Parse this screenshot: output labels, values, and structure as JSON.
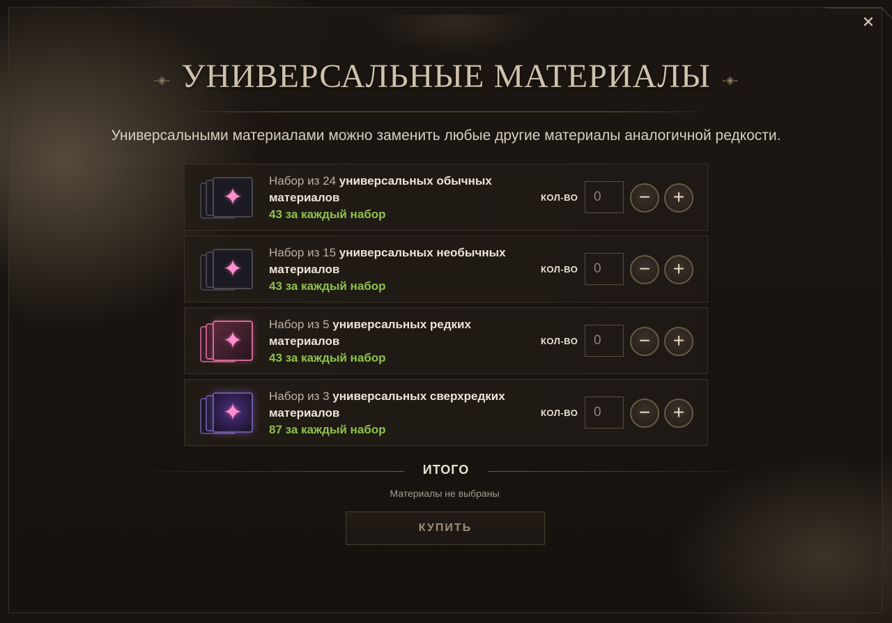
{
  "dialog": {
    "title": "УНИВЕРСАЛЬНЫЕ МАТЕРИАЛЫ",
    "close_glyph": "✕",
    "description": "Универсальными материалами можно заменить любые другие материалы аналогичной редкости."
  },
  "items": [
    {
      "prefix": "Набор из 24 ",
      "bold": "универсальных обычных материалов",
      "price": "43",
      "price_suffix": " за каждый набор",
      "qty_label": "КОЛ-ВО",
      "qty_value": "0",
      "rarity": "common"
    },
    {
      "prefix": "Набор из 15 ",
      "bold": "универсальных необычных материалов",
      "price": "43",
      "price_suffix": " за каждый набор",
      "qty_label": "КОЛ-ВО",
      "qty_value": "0",
      "rarity": "uncommon"
    },
    {
      "prefix": "Набор из 5 ",
      "bold": "универсальных редких материалов",
      "price": "43",
      "price_suffix": " за каждый набор",
      "qty_label": "КОЛ-ВО",
      "qty_value": "0",
      "rarity": "rare"
    },
    {
      "prefix": "Набор из 3 ",
      "bold": "универсальных сверхредких материалов",
      "price": "87",
      "price_suffix": " за каждый набор",
      "qty_label": "КОЛ-ВО",
      "qty_value": "0",
      "rarity": "epic"
    }
  ],
  "icons": {
    "minus": "−",
    "plus": "+",
    "star": "✦",
    "ornament_left": "-◈-",
    "ornament_right": "-◈-"
  },
  "summary": {
    "total_label": "ИТОГО",
    "note": "Материалы не выбраны",
    "buy_label": "КУПИТЬ"
  },
  "colors": {
    "price_green": "#8fc24e",
    "title_color": "#cfc2ac",
    "rare_pink": "#d36a98",
    "epic_purple": "#6c5aa0"
  }
}
